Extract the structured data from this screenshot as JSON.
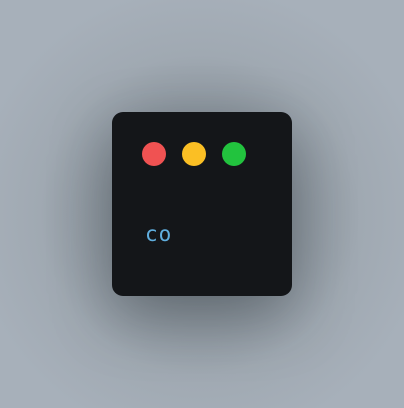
{
  "window": {
    "background": "#141619",
    "controls": [
      {
        "name": "close",
        "color": "#f05252"
      },
      {
        "name": "minimize",
        "color": "#fbbf24"
      },
      {
        "name": "maximize",
        "color": "#22c33e"
      }
    ],
    "code_text": "co",
    "code_color": "#60aede"
  }
}
